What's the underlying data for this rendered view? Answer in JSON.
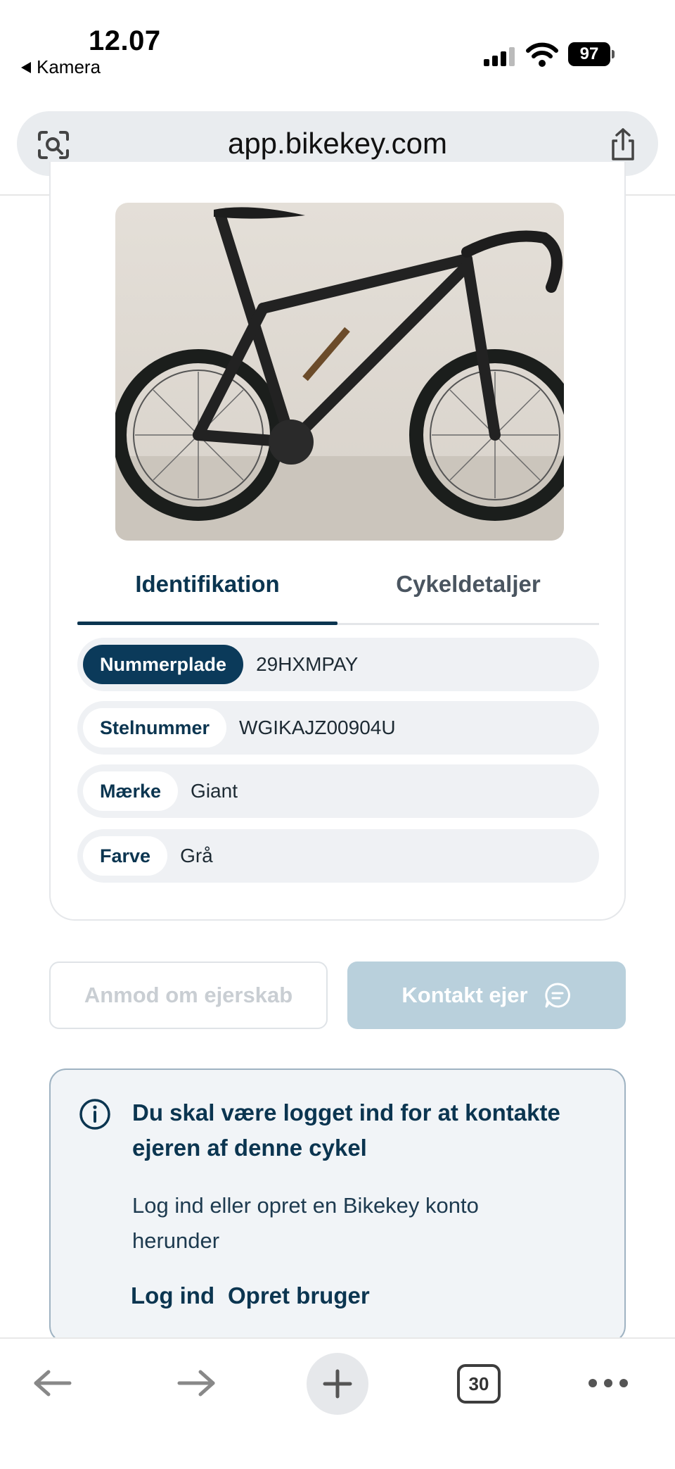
{
  "status_bar": {
    "time": "12.07",
    "back_app": "Kamera",
    "battery": "97"
  },
  "browser": {
    "url": "app.bikekey.com",
    "tab_count": "30"
  },
  "tabs": [
    {
      "label": "Identifikation",
      "active": true
    },
    {
      "label": "Cykeldetaljer",
      "active": false
    }
  ],
  "fields": [
    {
      "label": "Nummerplade",
      "value": "29HXMPAY"
    },
    {
      "label": "Stelnummer",
      "value": "WGIKAJZ00904U"
    },
    {
      "label": "Mærke",
      "value": "Giant"
    },
    {
      "label": "Farve",
      "value": "Grå"
    }
  ],
  "actions": {
    "request_ownership": "Anmod om ejerskab",
    "contact_owner": "Kontakt ejer"
  },
  "notice": {
    "title": "Du skal være logget ind for at kontakte ejeren af denne cykel",
    "text": "Log ind eller opret en Bikekey konto herunder",
    "login": "Log ind",
    "signup": "Opret bruger"
  },
  "colors": {
    "primary": "#0b3550",
    "button_disabled": "#b9d0dc",
    "info_bg": "#f1f4f7"
  }
}
